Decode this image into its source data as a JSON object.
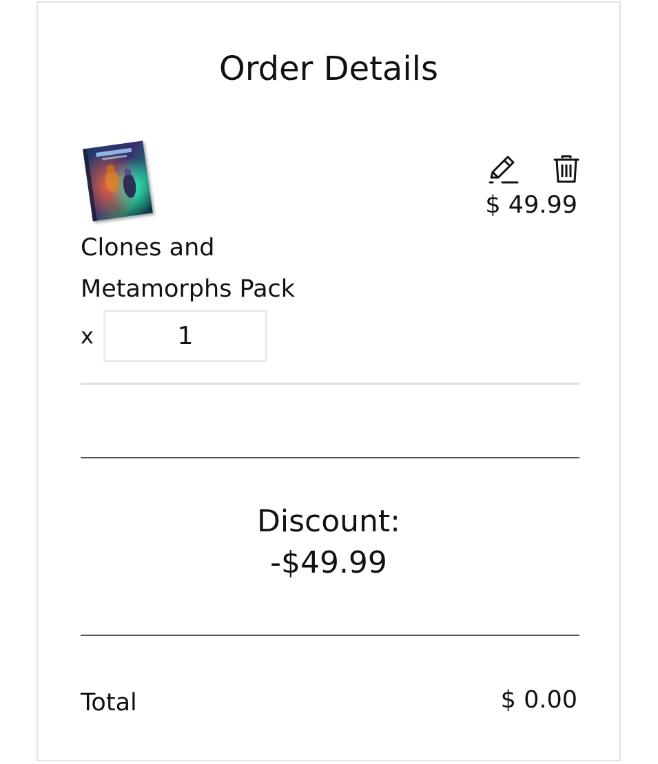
{
  "order": {
    "title": "Order Details"
  },
  "item": {
    "name": "Clones and Metamorphs Pack",
    "price": "$ 49.99",
    "quantity_prefix": "x",
    "quantity": "1",
    "image_icon": "product-box-art-icon",
    "edit_icon": "pencil-icon",
    "delete_icon": "trash-icon"
  },
  "discount": {
    "label": "Discount:",
    "value": "-$49.99"
  },
  "total": {
    "label": "Total",
    "value": "$ 0.00"
  },
  "colors": {
    "text": "#111111",
    "card_border": "#dfe3e6",
    "input_border": "#ebebeb",
    "divider_light": "#dde1e4",
    "divider_dark": "#555555"
  }
}
